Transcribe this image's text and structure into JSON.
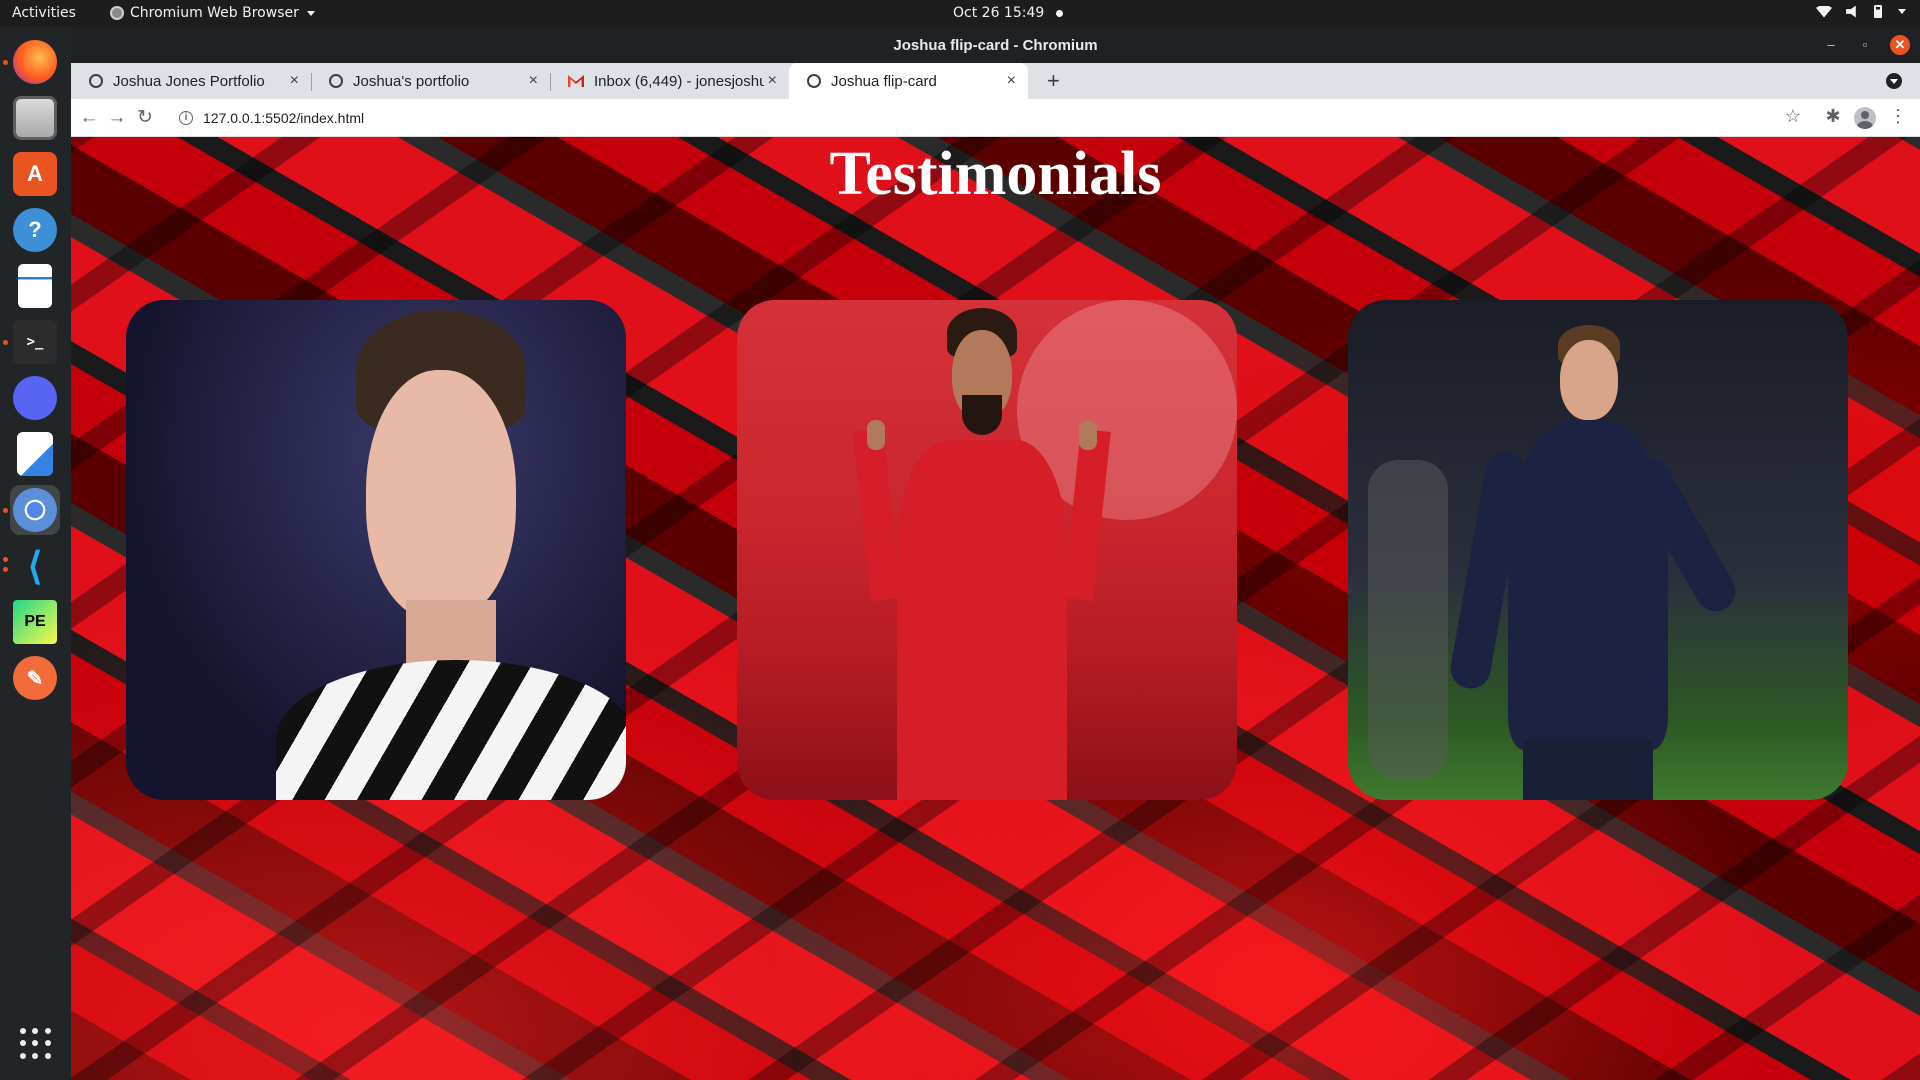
{
  "system": {
    "activities": "Activities",
    "app_name": "Chromium Web Browser",
    "clock": "Oct 26  15:49"
  },
  "dock": {
    "items": [
      "firefox-icon",
      "files-icon",
      "software-icon",
      "help-icon",
      "writer-icon",
      "terminal-icon",
      "discord-icon",
      "text-editor-icon",
      "chromium-icon",
      "vscode-icon",
      "pycharm-icon",
      "pen-icon"
    ]
  },
  "window": {
    "title": "Joshua flip-card - Chromium"
  },
  "tabs": [
    {
      "title": "Joshua Jones Portfolio",
      "close": "×"
    },
    {
      "title": "Joshua's portfolio",
      "close": "×"
    },
    {
      "title": "Inbox (6,449) - jonesjoshu",
      "close": "×"
    },
    {
      "title": "Joshua flip-card",
      "close": "×"
    }
  ],
  "toolbar": {
    "url": "127.0.0.1:5502/index.html",
    "new_tab": "+"
  },
  "page": {
    "heading": "Testimonials",
    "cards": [
      {
        "subject": "player-photo-1"
      },
      {
        "subject": "player-photo-2"
      },
      {
        "subject": "player-photo-3"
      }
    ],
    "colors": {
      "background": "#b5000a",
      "heading": "#ffffff"
    }
  }
}
